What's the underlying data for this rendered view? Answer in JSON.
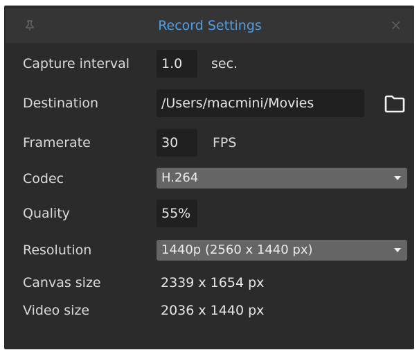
{
  "window": {
    "title": "Record Settings",
    "pin_icon": "pin-icon",
    "close_icon": "close-icon",
    "close_glyph": "×"
  },
  "capture_interval": {
    "label": "Capture interval",
    "value": "1.0",
    "unit": "sec."
  },
  "destination": {
    "label": "Destination",
    "value": "/Users/macmini/Movies",
    "browse_icon": "folder-icon"
  },
  "framerate": {
    "label": "Framerate",
    "value": "30",
    "unit": "FPS"
  },
  "codec": {
    "label": "Codec",
    "selected": "H.264"
  },
  "quality": {
    "label": "Quality",
    "value": "55%"
  },
  "resolution": {
    "label": "Resolution",
    "selected": "1440p (2560 x 1440 px)"
  },
  "canvas_size": {
    "label": "Canvas size",
    "value": "2339 x 1654 px"
  },
  "video_size": {
    "label": "Video size",
    "value": "2036 x 1440 px"
  },
  "colors": {
    "panel_bg": "#2b2b2b",
    "title_accent": "#4f9fe8",
    "field_bg": "#202020",
    "dropdown_bg": "#656565"
  }
}
